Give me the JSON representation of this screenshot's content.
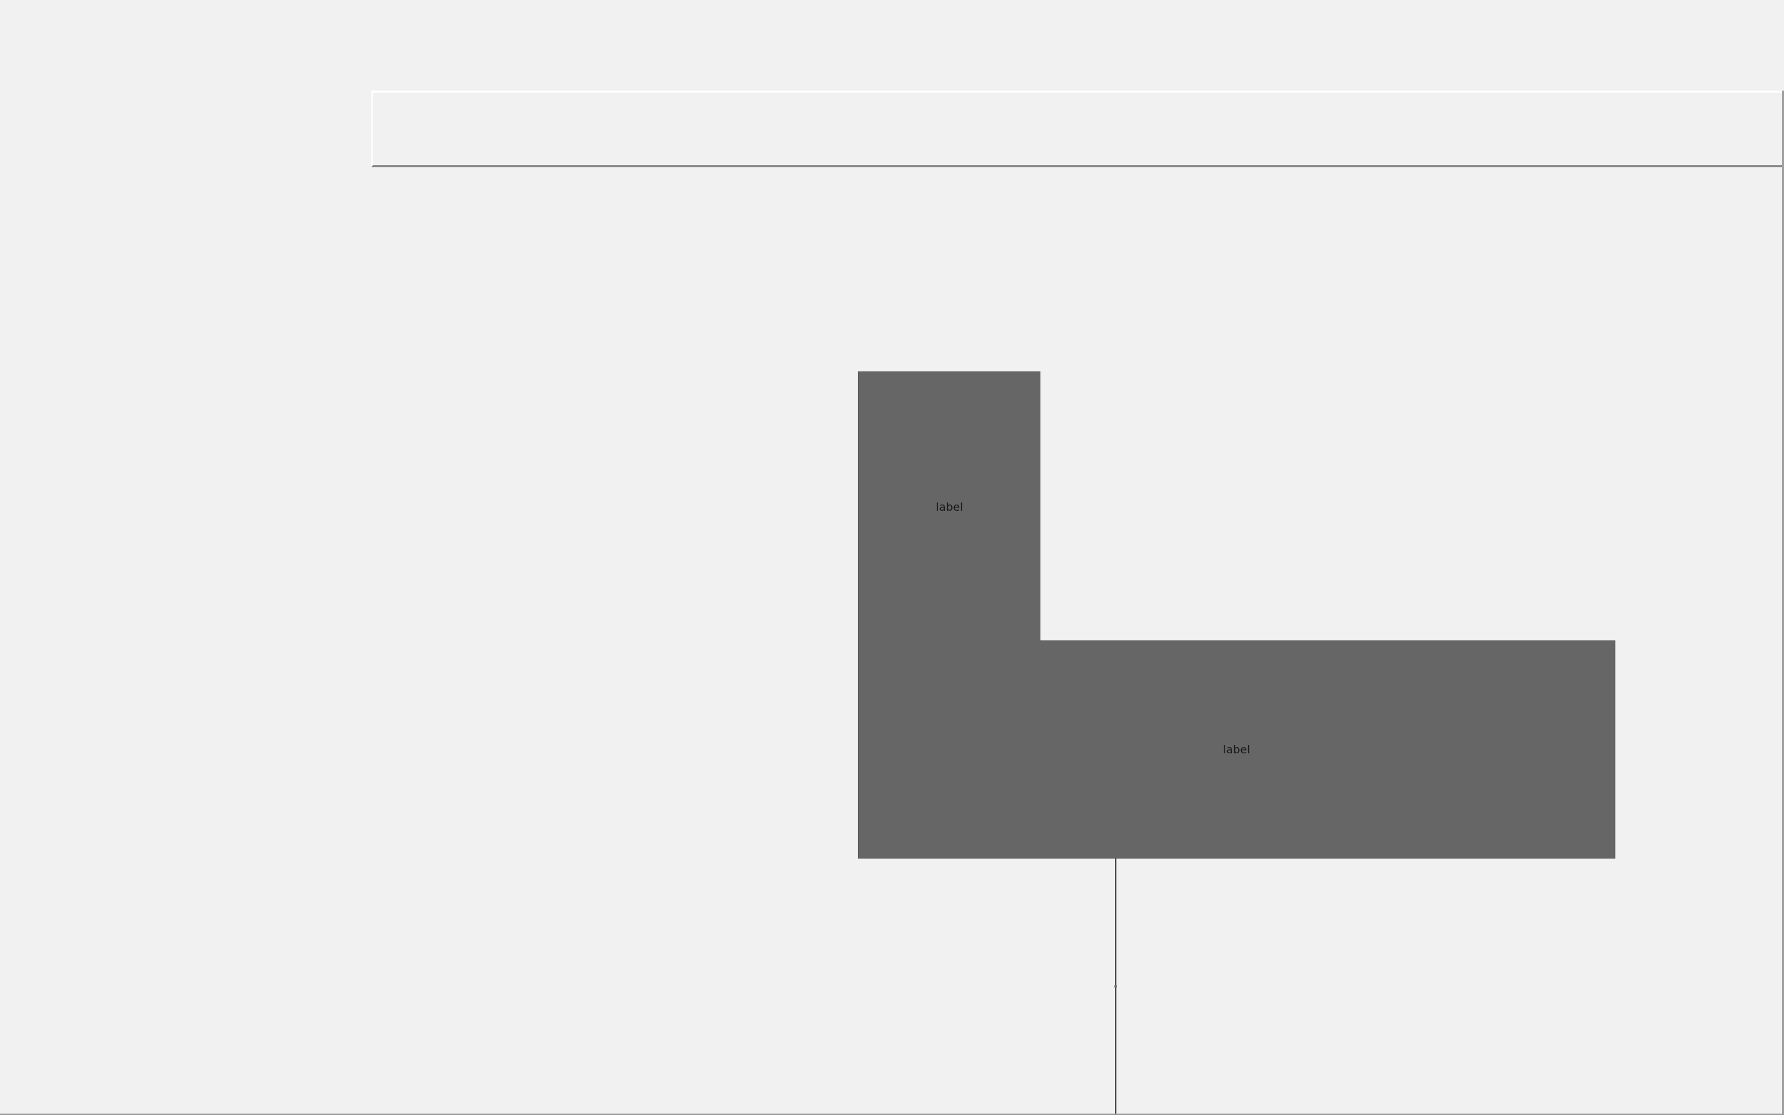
{
  "canvas": {
    "upper_block": {
      "label": "label"
    },
    "lower_block": {
      "label": "label"
    }
  },
  "colors": {
    "background": "#f1f1f1",
    "block_fill": "#666666",
    "line": "#4a4a4a"
  }
}
